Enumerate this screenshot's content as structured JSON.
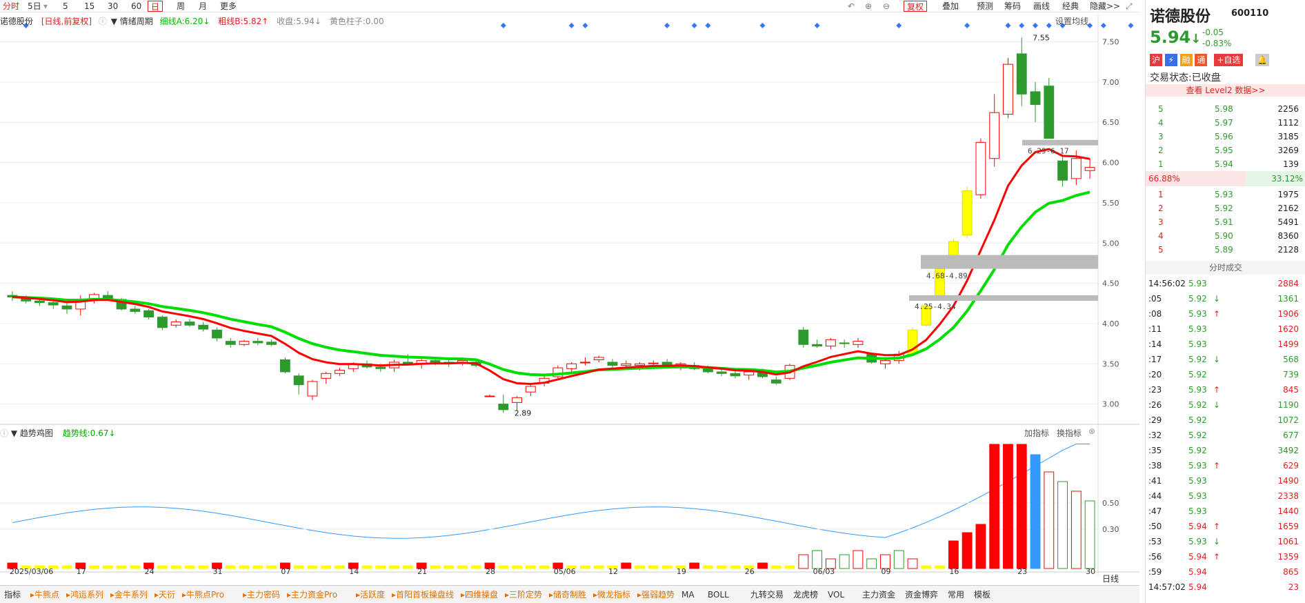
{
  "toolbar": {
    "left_items": [
      "分时",
      "5日",
      "5",
      "15",
      "30",
      "60",
      "日",
      "周",
      "月",
      "更多"
    ],
    "active": "日",
    "right_items": [
      "复权",
      "叠加",
      "预测",
      "筹码",
      "画线",
      "经典",
      "隐藏>>"
    ]
  },
  "info_line": {
    "stock": "诺德股份",
    "mode": "[日线,前复权]",
    "indicator": "情绪周期",
    "fine_line": "细线A:6.20↓",
    "thick_line": "粗线B:5.82↑",
    "close": "收盘:5.94↓",
    "yellow_bar": "黄色柱子:0.00",
    "settings": "设置均线"
  },
  "sub_panel": {
    "name": "趋势鸡图",
    "trend_line": "趋势线:0.67↓",
    "add_indicator": "加指标",
    "switch_indicator": "换指标",
    "y_ticks": [
      "0.50",
      "0.30"
    ],
    "axis_suffix": "日线"
  },
  "price_axis": [
    "7.50",
    "7.00",
    "6.50",
    "6.00",
    "5.50",
    "5.00",
    "4.50",
    "4.00",
    "3.50",
    "3.00"
  ],
  "date_axis": [
    "2025/03/06",
    "17",
    "24",
    "31",
    "07",
    "14",
    "21",
    "28",
    "05/06",
    "12",
    "19",
    "26",
    "06/03",
    "09",
    "16",
    "23",
    "30"
  ],
  "annotations": {
    "high": "7.55",
    "low": "2.89",
    "zone1": "6.29-6.17",
    "zone2": "4.68-4.89",
    "zone3": "4.25-4.34"
  },
  "bottom_tabs": [
    "指标",
    "牛熊点",
    "鸿运系列",
    "金牛系列",
    "天衍",
    "牛熊点Pro",
    "主力密码",
    "主力资金Pro",
    "活跃度",
    "首阳首板操盘线",
    "四维操盘",
    "三阶定势",
    "储奇制胜",
    "微龙指标",
    "强弱趋势",
    "MA",
    "BOLL",
    "九转交易",
    "龙虎榜",
    "VOL",
    "主力资金",
    "资金博弈",
    "常用",
    "模板"
  ],
  "quote": {
    "name": "诺德股份",
    "code": "600110",
    "price": "5.94",
    "arrow": "↓",
    "change": "-0.05",
    "change_pct": "-0.83%",
    "badges": [
      "沪",
      "融",
      "通"
    ],
    "add_watch": "+自选",
    "status_label": "交易状态:",
    "status_value": "已收盘",
    "level2": "查看 Level2 数据>>",
    "asks": [
      {
        "lvl": "5",
        "price": "5.98",
        "vol": "2256"
      },
      {
        "lvl": "4",
        "price": "5.97",
        "vol": "1112"
      },
      {
        "lvl": "3",
        "price": "5.96",
        "vol": "3185"
      },
      {
        "lvl": "2",
        "price": "5.95",
        "vol": "3269"
      },
      {
        "lvl": "1",
        "price": "5.94",
        "vol": "139"
      }
    ],
    "ratio_left": "66.88%",
    "ratio_right": "33.12%",
    "bids": [
      {
        "lvl": "1",
        "price": "5.93",
        "vol": "1975"
      },
      {
        "lvl": "2",
        "price": "5.92",
        "vol": "2162"
      },
      {
        "lvl": "3",
        "price": "5.91",
        "vol": "5491"
      },
      {
        "lvl": "4",
        "price": "5.90",
        "vol": "8360"
      },
      {
        "lvl": "5",
        "price": "5.89",
        "vol": "2128"
      }
    ],
    "trades_title": "分时成交",
    "trades": [
      {
        "t": "14:56:02",
        "p": "5.93",
        "v": "2884",
        "d": ""
      },
      {
        "t": ":05",
        "p": "5.92",
        "v": "1361",
        "d": "↓"
      },
      {
        "t": ":08",
        "p": "5.93",
        "v": "1906",
        "d": "↑"
      },
      {
        "t": ":11",
        "p": "5.93",
        "v": "1620",
        "d": ""
      },
      {
        "t": ":14",
        "p": "5.93",
        "v": "1499",
        "d": ""
      },
      {
        "t": ":17",
        "p": "5.92",
        "v": "568",
        "d": "↓"
      },
      {
        "t": ":20",
        "p": "5.92",
        "v": "739",
        "d": ""
      },
      {
        "t": ":23",
        "p": "5.93",
        "v": "845",
        "d": "↑"
      },
      {
        "t": ":26",
        "p": "5.92",
        "v": "1190",
        "d": "↓"
      },
      {
        "t": ":29",
        "p": "5.92",
        "v": "1072",
        "d": ""
      },
      {
        "t": ":32",
        "p": "5.92",
        "v": "677",
        "d": ""
      },
      {
        "t": ":35",
        "p": "5.92",
        "v": "3492",
        "d": ""
      },
      {
        "t": ":38",
        "p": "5.93",
        "v": "629",
        "d": "↑"
      },
      {
        "t": ":41",
        "p": "5.93",
        "v": "1490",
        "d": ""
      },
      {
        "t": ":44",
        "p": "5.93",
        "v": "2338",
        "d": ""
      },
      {
        "t": ":47",
        "p": "5.93",
        "v": "1440",
        "d": ""
      },
      {
        "t": ":50",
        "p": "5.94",
        "v": "1659",
        "d": "↑"
      },
      {
        "t": ":53",
        "p": "5.93",
        "v": "1061",
        "d": "↓"
      },
      {
        "t": ":56",
        "p": "5.94",
        "v": "1359",
        "d": "↑"
      },
      {
        "t": ":59",
        "p": "5.94",
        "v": "865",
        "d": ""
      },
      {
        "t": "14:57:02",
        "p": "5.94",
        "v": "23",
        "d": ""
      }
    ]
  },
  "colors": {
    "up": "#ff0000",
    "down": "#2e9a2e",
    "yellow": "#ffff00",
    "blue": "#3399ff",
    "green_line": "#00dd00"
  },
  "chart_data": {
    "type": "candlestick",
    "candles": [
      [
        4.35,
        4.4,
        4.28,
        4.33
      ],
      [
        4.32,
        4.35,
        4.25,
        4.28
      ],
      [
        4.28,
        4.32,
        4.22,
        4.26
      ],
      [
        4.26,
        4.3,
        4.18,
        4.23
      ],
      [
        4.22,
        4.28,
        4.12,
        4.18
      ],
      [
        4.18,
        4.35,
        4.1,
        4.3
      ],
      [
        4.3,
        4.38,
        4.25,
        4.36
      ],
      [
        4.35,
        4.4,
        4.28,
        4.3
      ],
      [
        4.3,
        4.32,
        4.16,
        4.18
      ],
      [
        4.18,
        4.22,
        4.12,
        4.15
      ],
      [
        4.16,
        4.18,
        4.05,
        4.08
      ],
      [
        4.08,
        4.1,
        3.92,
        3.95
      ],
      [
        3.98,
        4.05,
        3.95,
        4.02
      ],
      [
        4.02,
        4.06,
        3.96,
        3.98
      ],
      [
        3.98,
        4.02,
        3.9,
        3.93
      ],
      [
        3.92,
        3.95,
        3.78,
        3.82
      ],
      [
        3.78,
        3.82,
        3.7,
        3.74
      ],
      [
        3.74,
        3.8,
        3.72,
        3.78
      ],
      [
        3.78,
        3.82,
        3.73,
        3.76
      ],
      [
        3.77,
        3.8,
        3.72,
        3.74
      ],
      [
        3.55,
        3.58,
        3.38,
        3.4
      ],
      [
        3.35,
        3.38,
        3.12,
        3.24
      ],
      [
        3.1,
        3.3,
        3.05,
        3.28
      ],
      [
        3.32,
        3.4,
        3.25,
        3.38
      ],
      [
        3.38,
        3.45,
        3.35,
        3.42
      ],
      [
        3.44,
        3.52,
        3.4,
        3.5
      ],
      [
        3.5,
        3.54,
        3.44,
        3.46
      ],
      [
        3.46,
        3.5,
        3.4,
        3.44
      ],
      [
        3.45,
        3.55,
        3.4,
        3.52
      ],
      [
        3.52,
        3.62,
        3.48,
        3.5
      ],
      [
        3.5,
        3.56,
        3.44,
        3.54
      ],
      [
        3.54,
        3.58,
        3.48,
        3.52
      ],
      [
        3.52,
        3.56,
        3.46,
        3.5
      ],
      [
        3.52,
        3.58,
        3.48,
        3.54
      ],
      [
        3.52,
        3.55,
        3.46,
        3.48
      ],
      [
        3.1,
        3.12,
        3.1,
        3.1
      ],
      [
        3.0,
        3.12,
        2.89,
        2.93
      ],
      [
        3.02,
        3.1,
        2.92,
        3.08
      ],
      [
        3.15,
        3.25,
        3.1,
        3.22
      ],
      [
        3.26,
        3.35,
        3.22,
        3.32
      ],
      [
        3.34,
        3.48,
        3.3,
        3.45
      ],
      [
        3.44,
        3.52,
        3.4,
        3.5
      ],
      [
        3.52,
        3.58,
        3.48,
        3.52
      ],
      [
        3.55,
        3.6,
        3.52,
        3.58
      ],
      [
        3.52,
        3.56,
        3.44,
        3.48
      ],
      [
        3.48,
        3.54,
        3.44,
        3.5
      ],
      [
        3.48,
        3.52,
        3.42,
        3.5
      ],
      [
        3.5,
        3.54,
        3.46,
        3.51
      ],
      [
        3.52,
        3.56,
        3.46,
        3.48
      ],
      [
        3.46,
        3.52,
        3.42,
        3.5
      ],
      [
        3.48,
        3.52,
        3.42,
        3.44
      ],
      [
        3.44,
        3.48,
        3.38,
        3.4
      ],
      [
        3.4,
        3.44,
        3.35,
        3.38
      ],
      [
        3.38,
        3.42,
        3.32,
        3.35
      ],
      [
        3.36,
        3.42,
        3.3,
        3.4
      ],
      [
        3.4,
        3.44,
        3.32,
        3.34
      ],
      [
        3.3,
        3.34,
        3.24,
        3.26
      ],
      [
        3.32,
        3.5,
        3.3,
        3.48
      ],
      [
        3.92,
        3.96,
        3.7,
        3.74
      ],
      [
        3.74,
        3.8,
        3.7,
        3.72
      ],
      [
        3.72,
        3.82,
        3.68,
        3.8
      ],
      [
        3.76,
        3.8,
        3.7,
        3.75
      ],
      [
        3.74,
        3.82,
        3.7,
        3.78
      ],
      [
        3.62,
        3.64,
        3.5,
        3.52
      ],
      [
        3.5,
        3.56,
        3.44,
        3.54
      ],
      [
        3.54,
        3.66,
        3.5,
        3.62
      ],
      [
        3.62,
        3.95,
        3.6,
        3.92
      ],
      [
        3.98,
        4.25,
        3.96,
        4.22
      ],
      [
        4.35,
        4.75,
        4.32,
        4.68
      ],
      [
        4.8,
        5.05,
        4.78,
        5.02
      ],
      [
        5.1,
        5.7,
        5.06,
        5.65
      ],
      [
        5.6,
        6.3,
        5.55,
        6.25
      ],
      [
        6.05,
        6.85,
        5.95,
        6.62
      ],
      [
        6.6,
        7.3,
        6.55,
        7.22
      ],
      [
        7.35,
        7.55,
        6.7,
        6.85
      ],
      [
        6.88,
        7.0,
        6.5,
        6.72
      ],
      [
        6.95,
        7.05,
        6.55,
        6.3
      ],
      [
        6.02,
        6.1,
        5.7,
        5.78
      ],
      [
        5.8,
        6.15,
        5.72,
        6.05
      ],
      [
        5.9,
        6.05,
        5.8,
        5.94
      ]
    ],
    "ylim": [
      2.8,
      7.65
    ]
  }
}
